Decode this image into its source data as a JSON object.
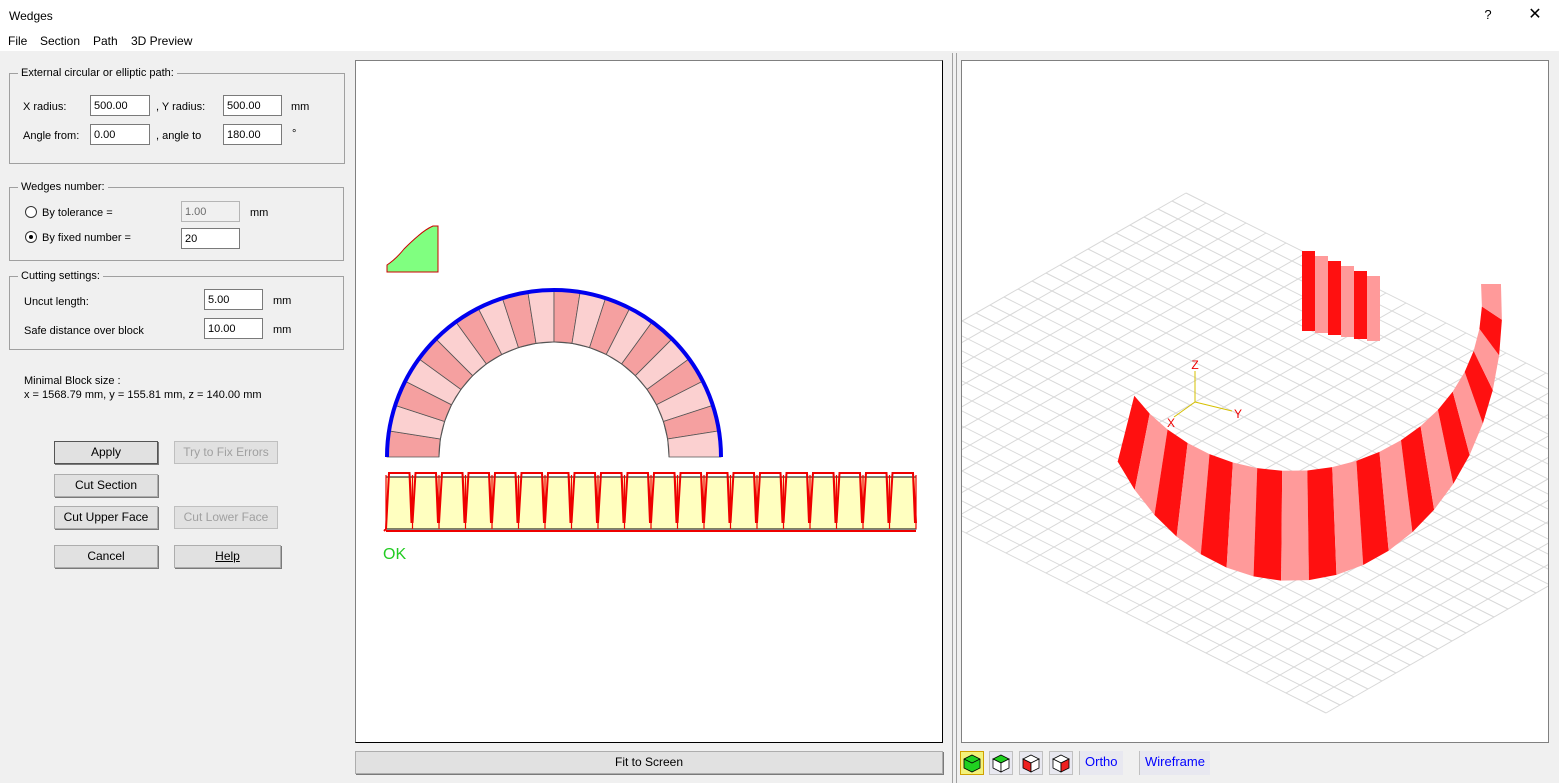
{
  "window": {
    "title": "Wedges",
    "help": "?",
    "close": "✕"
  },
  "menu": [
    "File",
    "Section",
    "Path",
    "3D Preview"
  ],
  "path_group": {
    "legend": "External circular or elliptic path:",
    "x_radius_label": "X radius:",
    "x_radius": "500.00",
    "y_radius_label": ",  Y radius:",
    "y_radius": "500.00",
    "radius_unit": "mm",
    "angle_from_label": "Angle from:",
    "angle_from": "0.00",
    "angle_to_label": ", angle to",
    "angle_to": "180.00",
    "angle_unit": "°"
  },
  "wedges_group": {
    "legend": "Wedges number:",
    "by_tolerance_label": "By tolerance =",
    "tolerance": "1.00",
    "tolerance_unit": "mm",
    "by_fixed_label": "By fixed number =",
    "fixed_number": "20",
    "selected": "fixed"
  },
  "cutting_group": {
    "legend": "Cutting settings:",
    "uncut_length_label": "Uncut length:",
    "uncut_length": "5.00",
    "uncut_unit": "mm",
    "safe_distance_label": "Safe distance over block",
    "safe_distance": "10.00",
    "safe_unit": "mm"
  },
  "minimal_block": {
    "title": "Minimal Block size :",
    "value": "x = 1568.79 mm, y = 155.81 mm, z = 140.00 mm"
  },
  "buttons": {
    "apply": "Apply",
    "try_fix": "Try to Fix Errors",
    "cut_section": "Cut Section",
    "cut_upper": "Cut Upper Face",
    "cut_lower": "Cut Lower Face",
    "cancel": "Cancel",
    "help": "Help"
  },
  "preview2d": {
    "status": "OK",
    "fit_to_screen": "Fit to Screen",
    "wedge_count": 20,
    "status_color": "#22cc22",
    "path_color": "#0000ee",
    "wedge_color_a": "#f5a0a0",
    "wedge_color_b": "#fbd0d0",
    "strip_fill": "#ffffc0",
    "cut_line_color": "#ee0000",
    "section_fill": "#80ff80"
  },
  "preview3d": {
    "axis_x": "X",
    "axis_y": "Y",
    "axis_z": "Z",
    "ortho": "Ortho",
    "wireframe": "Wireframe",
    "view_buttons": [
      "view-iso-icon",
      "view-top-icon",
      "view-front-icon",
      "view-side-icon"
    ],
    "stripe_red": "#ff1010",
    "stripe_pink": "#ff9a9a"
  }
}
